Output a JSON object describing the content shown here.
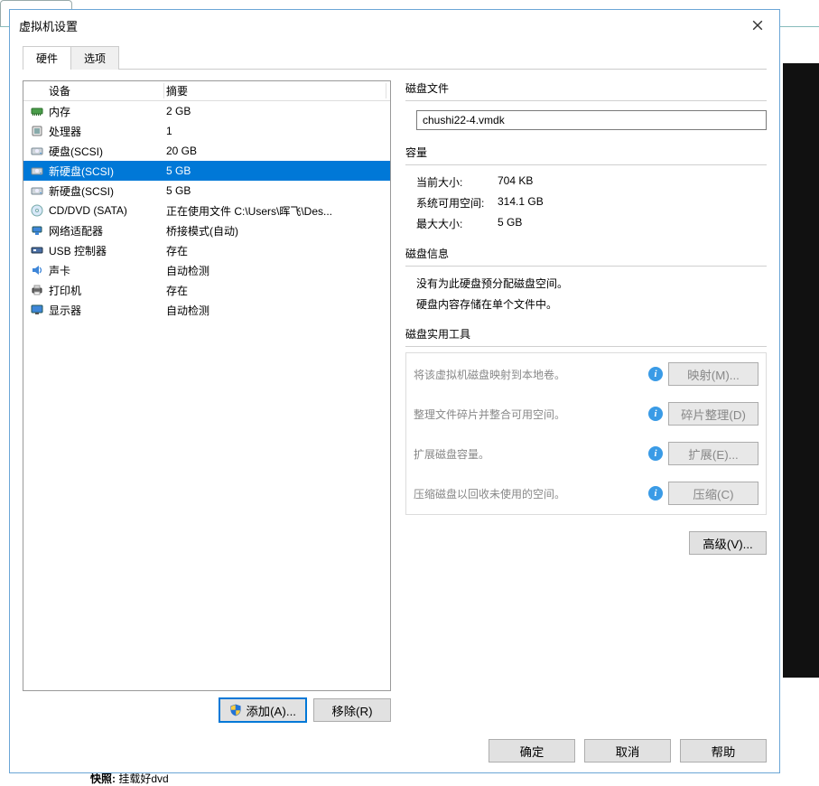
{
  "dialog": {
    "title": "虚拟机设置",
    "tabs": {
      "hardware": "硬件",
      "options": "选项"
    },
    "footer": {
      "ok": "确定",
      "cancel": "取消",
      "help": "帮助"
    }
  },
  "hwlist": {
    "head_device": "设备",
    "head_summary": "摘要",
    "add_btn": "添加(A)...",
    "remove_btn": "移除(R)",
    "items": [
      {
        "icon": "memory-icon",
        "device": "内存",
        "summary": "2 GB"
      },
      {
        "icon": "cpu-icon",
        "device": "处理器",
        "summary": "1"
      },
      {
        "icon": "disk-icon",
        "device": "硬盘(SCSI)",
        "summary": "20 GB"
      },
      {
        "icon": "disk-icon",
        "device": "新硬盘(SCSI)",
        "summary": "5 GB",
        "selected": true
      },
      {
        "icon": "disk-icon",
        "device": "新硬盘(SCSI)",
        "summary": "5 GB"
      },
      {
        "icon": "optical-icon",
        "device": "CD/DVD (SATA)",
        "summary": "正在使用文件 C:\\Users\\晖飞\\Des..."
      },
      {
        "icon": "network-icon",
        "device": "网络适配器",
        "summary": "桥接模式(自动)"
      },
      {
        "icon": "usb-icon",
        "device": "USB 控制器",
        "summary": "存在"
      },
      {
        "icon": "sound-icon",
        "device": "声卡",
        "summary": "自动检测"
      },
      {
        "icon": "printer-icon",
        "device": "打印机",
        "summary": "存在"
      },
      {
        "icon": "display-icon",
        "device": "显示器",
        "summary": "自动检测"
      }
    ]
  },
  "right": {
    "diskfile": {
      "title": "磁盘文件",
      "value": "chushi22-4.vmdk"
    },
    "capacity": {
      "title": "容量",
      "current_k": "当前大小:",
      "current_v": "704 KB",
      "free_k": "系统可用空间:",
      "free_v": "314.1 GB",
      "max_k": "最大大小:",
      "max_v": "5 GB"
    },
    "info": {
      "title": "磁盘信息",
      "line1": "没有为此硬盘预分配磁盘空间。",
      "line2": "硬盘内容存储在单个文件中。"
    },
    "tools": {
      "title": "磁盘实用工具",
      "map_desc": "将该虚拟机磁盘映射到本地卷。",
      "map_btn": "映射(M)...",
      "defrag_desc": "整理文件碎片并整合可用空间。",
      "defrag_btn": "碎片整理(D)",
      "expand_desc": "扩展磁盘容量。",
      "expand_btn": "扩展(E)...",
      "compact_desc": "压缩磁盘以回收未使用的空间。",
      "compact_btn": "压缩(C)"
    },
    "advanced_btn": "高级(V)..."
  },
  "background": {
    "snapshot_label": "快照:",
    "snapshot_value": "挂载好dvd"
  }
}
